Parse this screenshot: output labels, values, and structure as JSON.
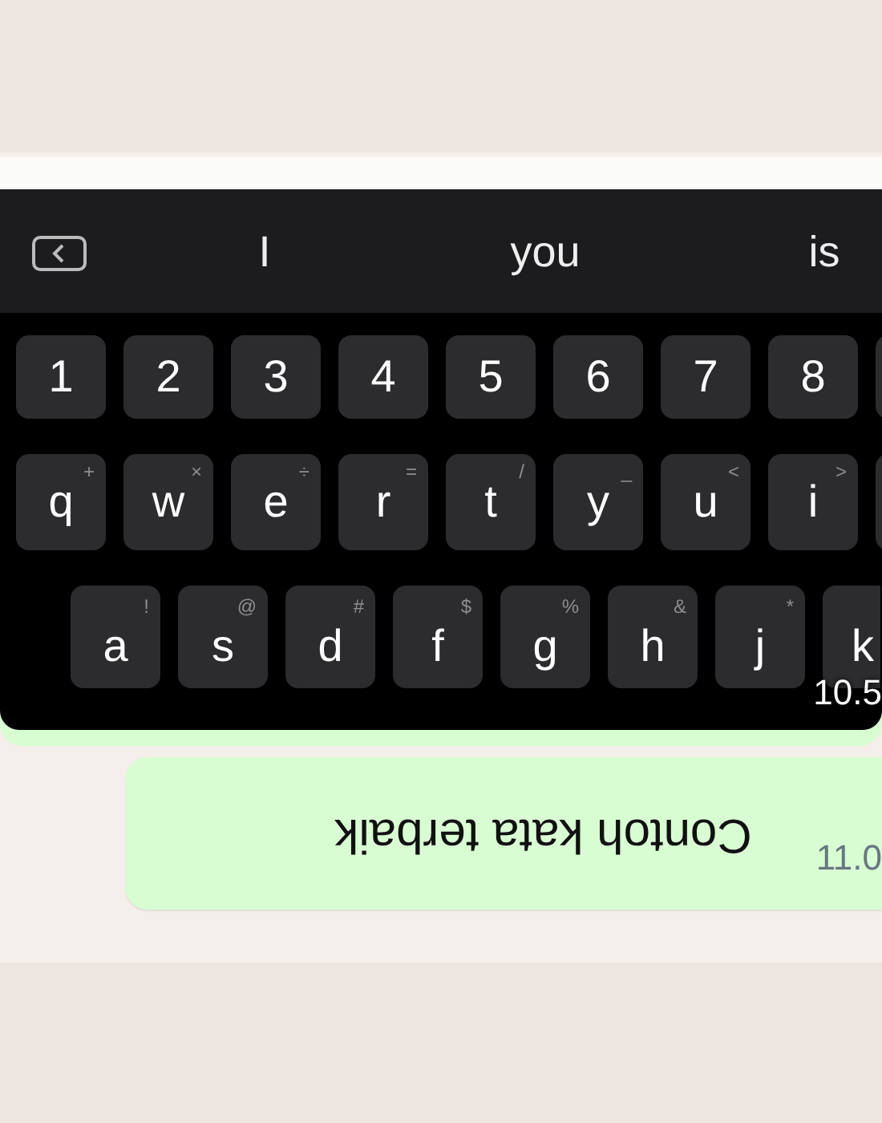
{
  "image_message": {
    "keyboard": {
      "suggestions": [
        "I",
        "you",
        "is"
      ],
      "number_row": [
        "1",
        "2",
        "3",
        "4",
        "5",
        "6",
        "7",
        "8"
      ],
      "letter_rows": [
        [
          {
            "key": "q",
            "alt": "+"
          },
          {
            "key": "w",
            "alt": "×"
          },
          {
            "key": "e",
            "alt": "÷"
          },
          {
            "key": "r",
            "alt": "="
          },
          {
            "key": "t",
            "alt": "/"
          },
          {
            "key": "y",
            "alt": "_"
          },
          {
            "key": "u",
            "alt": "<"
          },
          {
            "key": "i",
            "alt": ">"
          }
        ],
        [
          {
            "key": "a",
            "alt": "!"
          },
          {
            "key": "s",
            "alt": "@"
          },
          {
            "key": "d",
            "alt": "#"
          },
          {
            "key": "f",
            "alt": "$"
          },
          {
            "key": "g",
            "alt": "%"
          },
          {
            "key": "h",
            "alt": "&"
          },
          {
            "key": "j",
            "alt": "*"
          },
          {
            "key": "k"
          }
        ]
      ]
    },
    "time": "10.5"
  },
  "text_message": {
    "text": "Contoh kata terbaik",
    "upside_down": true,
    "time": "11.0"
  }
}
